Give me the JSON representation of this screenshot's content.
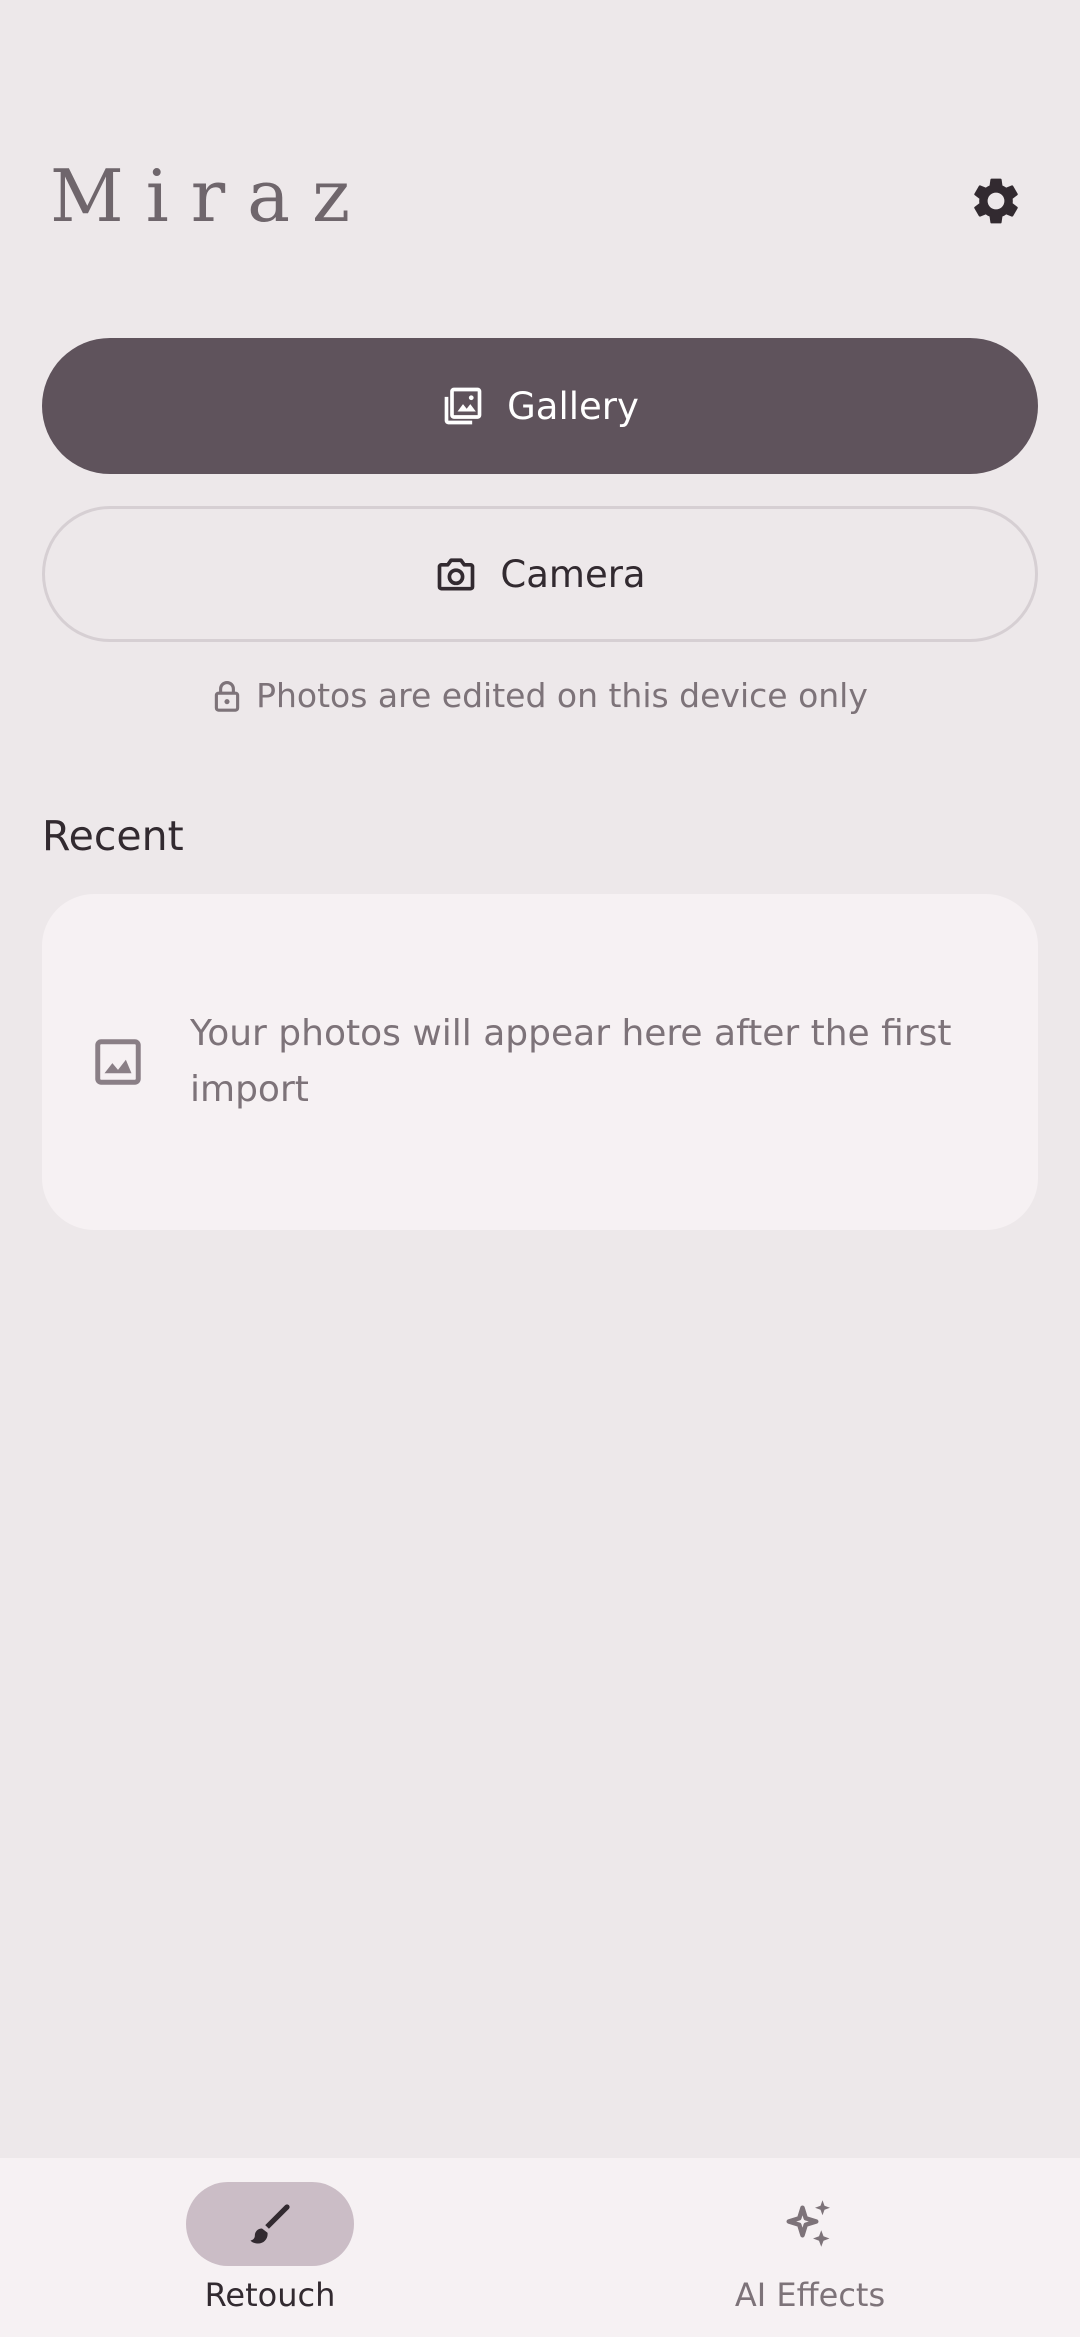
{
  "header": {
    "title": "Miraz",
    "settings_icon": "gear-icon"
  },
  "actions": {
    "gallery_label": "Gallery",
    "gallery_icon": "photo-library-icon",
    "camera_label": "Camera",
    "camera_icon": "camera-icon"
  },
  "privacy_note": {
    "icon": "lock-icon",
    "text": "Photos are edited on this device only"
  },
  "recent": {
    "title": "Recent",
    "empty_icon": "image-icon",
    "empty_text": "Your photos will appear here after the first import"
  },
  "bottom_nav": {
    "items": [
      {
        "label": "Retouch",
        "icon": "brush-icon",
        "active": true
      },
      {
        "label": "AI Effects",
        "icon": "sparkles-icon",
        "active": false
      }
    ]
  },
  "colors": {
    "background": "#EDE8EA",
    "primary_button": "#5F535C",
    "card": "#F6F1F3",
    "active_pill": "#CBBDC6",
    "text_primary": "#322A30",
    "text_secondary": "#7D7379"
  }
}
